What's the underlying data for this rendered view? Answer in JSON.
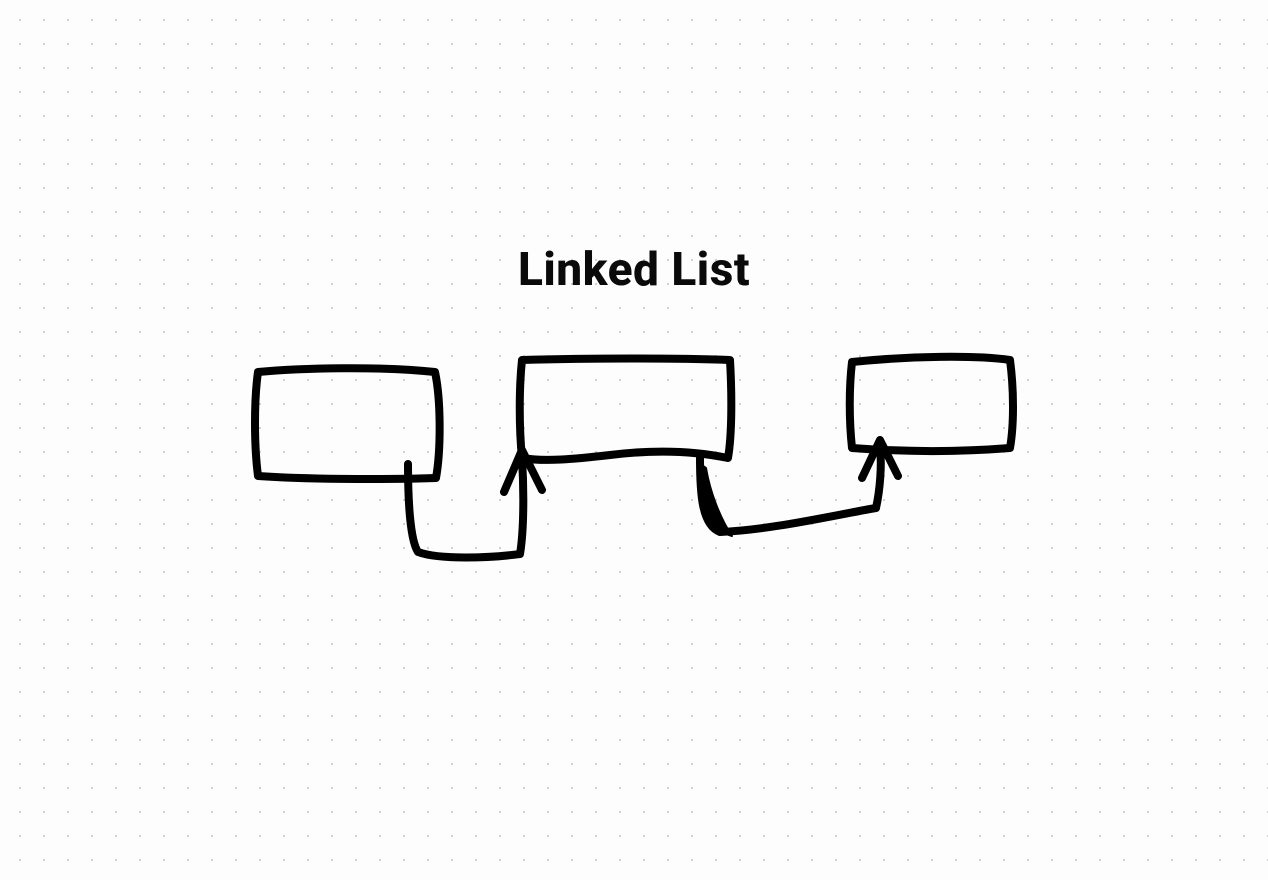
{
  "title": "Linked List",
  "nodes": [
    {
      "id": "node-1"
    },
    {
      "id": "node-2"
    },
    {
      "id": "node-3"
    }
  ],
  "links": [
    {
      "from": "node-1",
      "to": "node-2"
    },
    {
      "from": "node-2",
      "to": "node-3"
    }
  ],
  "stroke_color": "#000000",
  "stroke_width": 8
}
